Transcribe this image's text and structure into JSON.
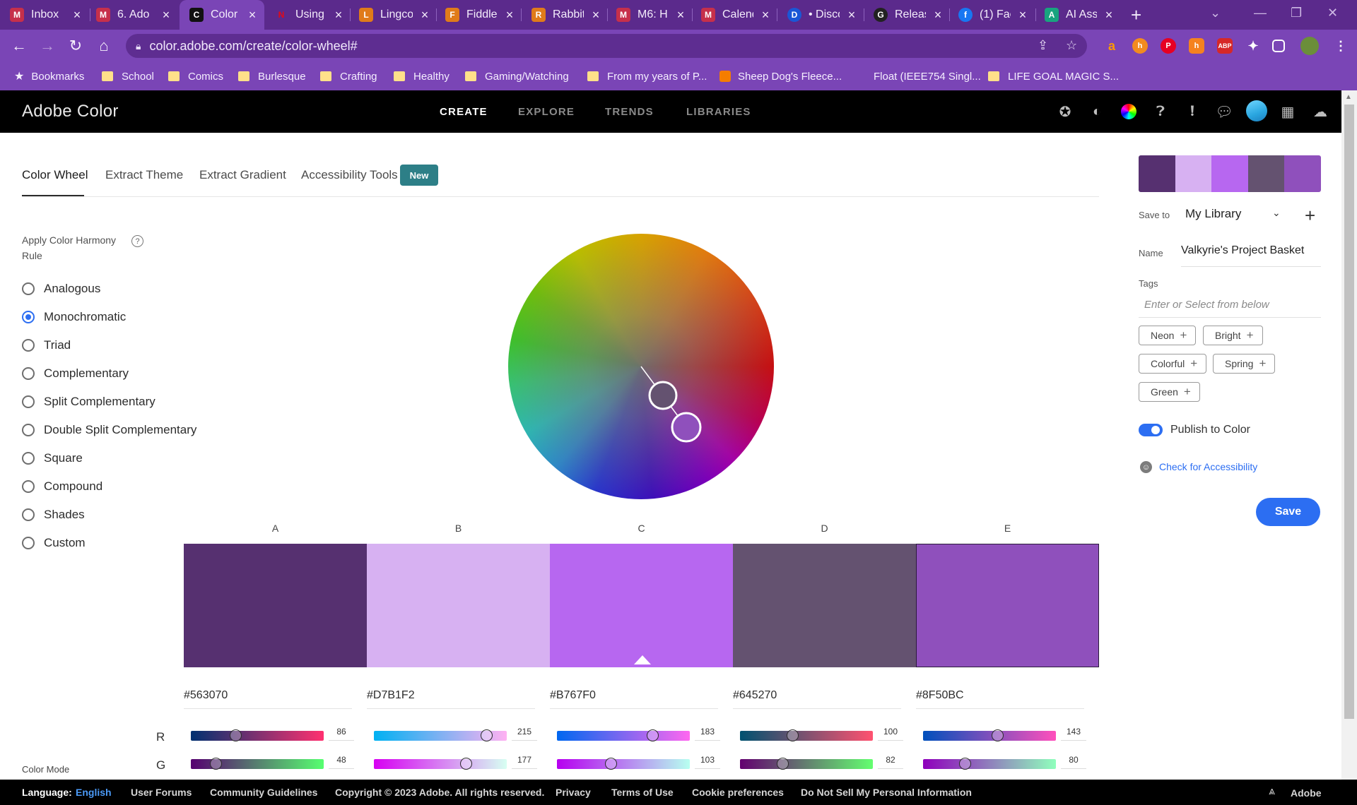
{
  "browser": {
    "tabs": [
      {
        "title": "Inbox",
        "favicon_color": "#c6304b",
        "favicon_text": "M",
        "active": false
      },
      {
        "title": "6. Ado",
        "favicon_color": "#c6304b",
        "favicon_text": "M",
        "active": false
      },
      {
        "title": "Color",
        "favicon_color": "#111111",
        "favicon_text": "C",
        "active": true
      },
      {
        "title": "Using",
        "favicon_color": "#e50914",
        "favicon_text": "N",
        "active": false
      },
      {
        "title": "Lingco",
        "favicon_color": "#e07b1a",
        "favicon_text": "L",
        "active": false
      },
      {
        "title": "Fiddle",
        "favicon_color": "#e07b1a",
        "favicon_text": "F",
        "active": false
      },
      {
        "title": "Rabbit",
        "favicon_color": "#e07b1a",
        "favicon_text": "R",
        "active": false
      },
      {
        "title": "M6: H",
        "favicon_color": "#c6304b",
        "favicon_text": "M",
        "active": false
      },
      {
        "title": "Calend",
        "favicon_color": "#c6304b",
        "favicon_text": "M",
        "active": false
      },
      {
        "title": "• Disco",
        "favicon_color": "#1a57d6",
        "favicon_text": "D",
        "active": false
      },
      {
        "title": "Releas",
        "favicon_color": "#222222",
        "favicon_text": "G",
        "active": false
      },
      {
        "title": "(1) Fac",
        "favicon_color": "#1877f2",
        "favicon_text": "f",
        "active": false
      },
      {
        "title": "AI Ass",
        "favicon_color": "#19a37f",
        "favicon_text": "A",
        "active": false
      }
    ],
    "url": "color.adobe.com/create/color-wheel#",
    "bookmarks": [
      {
        "label": "Bookmarks",
        "kind": "star"
      },
      {
        "label": "School",
        "kind": "folder"
      },
      {
        "label": "Comics",
        "kind": "folder"
      },
      {
        "label": "Burlesque",
        "kind": "folder"
      },
      {
        "label": "Crafting",
        "kind": "folder"
      },
      {
        "label": "Healthy",
        "kind": "folder"
      },
      {
        "label": "Gaming/Watching",
        "kind": "folder"
      },
      {
        "label": "From my years of P...",
        "kind": "folder"
      },
      {
        "label": "Sheep Dog's Fleece...",
        "kind": "blogger"
      },
      {
        "label": "Float (IEEE754 Singl...",
        "kind": "none"
      },
      {
        "label": "LIFE GOAL MAGIC S...",
        "kind": "folder"
      }
    ]
  },
  "header": {
    "brand": "Adobe Color",
    "nav": [
      "CREATE",
      "EXPLORE",
      "TRENDS",
      "LIBRARIES"
    ],
    "active_nav": "CREATE"
  },
  "subnav": {
    "tabs": [
      "Color Wheel",
      "Extract Theme",
      "Extract Gradient",
      "Accessibility Tools"
    ],
    "badge": "New"
  },
  "harmony": {
    "title": "Apply Color Harmony Rule",
    "help": "?",
    "rules": [
      "Analogous",
      "Monochromatic",
      "Triad",
      "Complementary",
      "Split Complementary",
      "Double Split Complementary",
      "Square",
      "Compound",
      "Shades",
      "Custom"
    ],
    "selected": "Monochromatic"
  },
  "swatches": [
    {
      "label": "A",
      "hex": "#563070",
      "r": 86,
      "g": 48
    },
    {
      "label": "B",
      "hex": "#D7B1F2",
      "r": 215,
      "g": 177
    },
    {
      "label": "C",
      "hex": "#B767F0",
      "r": 183,
      "g": 103
    },
    {
      "label": "D",
      "hex": "#645270",
      "r": 100,
      "g": 82
    },
    {
      "label": "E",
      "hex": "#8F50BC",
      "r": 143,
      "g": 80
    }
  ],
  "channels": [
    "R",
    "G"
  ],
  "color_mode_label": "Color Mode",
  "panel": {
    "save_to_label": "Save to",
    "library": "My Library",
    "name_label": "Name",
    "name_value": "Valkyrie's Project Basket",
    "tags_label": "Tags",
    "tags_placeholder": "Enter or Select from below",
    "tags": [
      "Neon",
      "Bright",
      "Colorful",
      "Spring",
      "Green"
    ],
    "publish_label": "Publish to Color",
    "publish_on": true,
    "accessibility_link": "Check for Accessibility",
    "save_button": "Save"
  },
  "footer": {
    "language_label": "Language:",
    "language": "English",
    "links": [
      "User Forums",
      "Community Guidelines",
      "Copyright © 2023 Adobe. All rights reserved.",
      "Privacy",
      "Terms of Use",
      "Cookie preferences",
      "Do Not Sell My Personal Information"
    ],
    "brand": "Adobe"
  },
  "colors": {
    "accent": "#2c6ef2",
    "chrome": "#7a45b6",
    "badge": "#2d7f87"
  }
}
